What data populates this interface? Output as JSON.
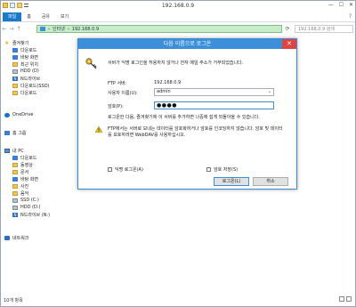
{
  "window": {
    "title": "192.168.0.9",
    "controls": [
      "—",
      "☐",
      "✕"
    ]
  },
  "ribbon": {
    "tabs": [
      "파일",
      "홈",
      "공유",
      "보기"
    ],
    "help": "?"
  },
  "nav": {
    "back": "←",
    "forward": "→",
    "up": "↑",
    "address_segments": [
      "인터넷",
      "192.168.0.9"
    ],
    "search_placeholder": "192.168.0.9 검색"
  },
  "sidebar": {
    "favorites_title": "즐겨찾기",
    "favorites": [
      "다운로드",
      "바탕 화면",
      "최근 위치",
      "HDD (D)",
      "N드라이브",
      "다운로드(SSD)",
      "다운로드"
    ],
    "onedrive": "OneDrive",
    "homegroup": "홈 그룹",
    "thispc_title": "내 PC",
    "thispc": [
      "다운로드",
      "동영상",
      "문서",
      "바탕 화면",
      "사진",
      "음악",
      "SSD (C:)",
      "HDD (D:)",
      "N드라이브 (N:)"
    ],
    "network": "네트워크"
  },
  "status": {
    "count": "10개 항목"
  },
  "dialog": {
    "title": "다음 이름으로 로그온",
    "close": "✕",
    "message": "서버가 익명 로그인을 허용하지 않거나 전자 메일 주소가 거부되었습니다.",
    "server_label": "FTP 서버:",
    "server_value": "192.168.0.9",
    "user_label": "사용자 이름(U):",
    "user_value": "admin",
    "password_label": "암호(P):",
    "password_value": "●●●●",
    "note": "로그온한 다음, 즐겨찾기에 이 서버를 추가하면 나중에 쉽게 되돌아올 수 있습니다.",
    "warning": "FTP에서는 서버로 보내는 데이터를 암호화하거나 암호를 인코딩하지 않습니다. 암호 및 데이터를 보호하려면 WebDAV를 사용하십시오.",
    "anon_label": "익명 로그온(A)",
    "save_label": "암호 저장(S)",
    "login_button": "로그온(L)",
    "cancel_button": "취소"
  }
}
